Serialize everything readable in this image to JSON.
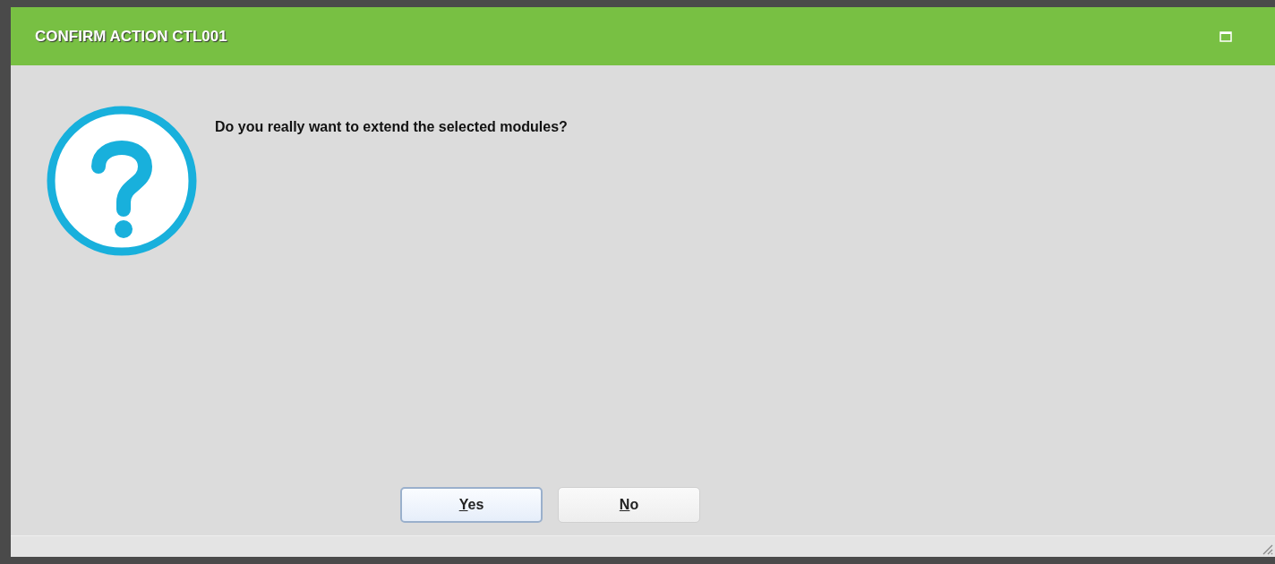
{
  "window": {
    "title": "CONFIRM ACTION CTL001"
  },
  "message": "Do you really want to extend the selected modules?",
  "buttons": [
    {
      "label": "Yes",
      "focused": true
    },
    {
      "label": "No",
      "focused": false
    }
  ]
}
